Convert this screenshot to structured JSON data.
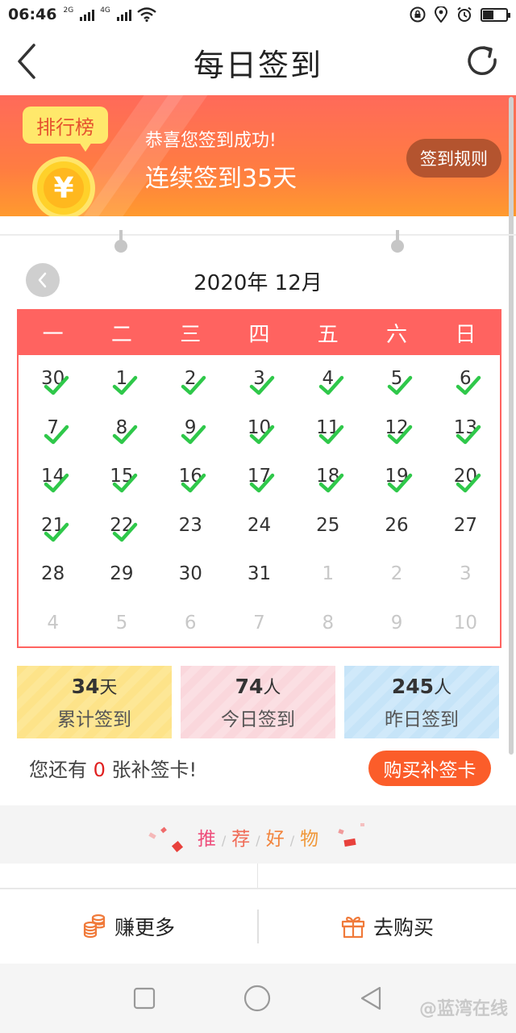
{
  "status_bar": {
    "time": "06:46",
    "net1": "2G",
    "net2": "4G",
    "icons": [
      "signal-icon",
      "signal-icon",
      "wifi-icon",
      "lock-icon",
      "location-icon",
      "alarm-icon",
      "battery-icon"
    ],
    "battery_level": 0.45
  },
  "header": {
    "title": "每日签到",
    "back_icon": "chevron-left-icon",
    "refresh_icon": "refresh-icon"
  },
  "banner": {
    "rank_label": "排行榜",
    "coin_symbol": "¥",
    "success_text": "恭喜您签到成功!",
    "streak_text": "连续签到35天",
    "rules_button": "签到规则"
  },
  "calendar": {
    "month_label": "2020年 12月",
    "weekdays": [
      "一",
      "二",
      "三",
      "四",
      "五",
      "六",
      "日"
    ],
    "days": [
      {
        "label": "30",
        "muted": false,
        "checked": true
      },
      {
        "label": "1",
        "muted": false,
        "checked": true
      },
      {
        "label": "2",
        "muted": false,
        "checked": true
      },
      {
        "label": "3",
        "muted": false,
        "checked": true
      },
      {
        "label": "4",
        "muted": false,
        "checked": true
      },
      {
        "label": "5",
        "muted": false,
        "checked": true
      },
      {
        "label": "6",
        "muted": false,
        "checked": true
      },
      {
        "label": "7",
        "muted": false,
        "checked": true
      },
      {
        "label": "8",
        "muted": false,
        "checked": true
      },
      {
        "label": "9",
        "muted": false,
        "checked": true
      },
      {
        "label": "10",
        "muted": false,
        "checked": true
      },
      {
        "label": "11",
        "muted": false,
        "checked": true
      },
      {
        "label": "12",
        "muted": false,
        "checked": true
      },
      {
        "label": "13",
        "muted": false,
        "checked": true
      },
      {
        "label": "14",
        "muted": false,
        "checked": true
      },
      {
        "label": "15",
        "muted": false,
        "checked": true
      },
      {
        "label": "16",
        "muted": false,
        "checked": true
      },
      {
        "label": "17",
        "muted": false,
        "checked": true
      },
      {
        "label": "18",
        "muted": false,
        "checked": true
      },
      {
        "label": "19",
        "muted": false,
        "checked": true
      },
      {
        "label": "20",
        "muted": false,
        "checked": true
      },
      {
        "label": "21",
        "muted": false,
        "checked": true
      },
      {
        "label": "22",
        "muted": false,
        "checked": true
      },
      {
        "label": "23",
        "muted": false,
        "checked": false
      },
      {
        "label": "24",
        "muted": false,
        "checked": false
      },
      {
        "label": "25",
        "muted": false,
        "checked": false
      },
      {
        "label": "26",
        "muted": false,
        "checked": false
      },
      {
        "label": "27",
        "muted": false,
        "checked": false
      },
      {
        "label": "28",
        "muted": false,
        "checked": false
      },
      {
        "label": "29",
        "muted": false,
        "checked": false
      },
      {
        "label": "30",
        "muted": false,
        "checked": false
      },
      {
        "label": "31",
        "muted": false,
        "checked": false
      },
      {
        "label": "1",
        "muted": true,
        "checked": false
      },
      {
        "label": "2",
        "muted": true,
        "checked": false
      },
      {
        "label": "3",
        "muted": true,
        "checked": false
      },
      {
        "label": "4",
        "muted": true,
        "checked": false
      },
      {
        "label": "5",
        "muted": true,
        "checked": false
      },
      {
        "label": "6",
        "muted": true,
        "checked": false
      },
      {
        "label": "7",
        "muted": true,
        "checked": false
      },
      {
        "label": "8",
        "muted": true,
        "checked": false
      },
      {
        "label": "9",
        "muted": true,
        "checked": false
      },
      {
        "label": "10",
        "muted": true,
        "checked": false
      }
    ]
  },
  "stats": {
    "total": {
      "value": "34",
      "unit": "天",
      "label": "累计签到"
    },
    "today": {
      "value": "74",
      "unit": "人",
      "label": "今日签到"
    },
    "yesterday": {
      "value": "245",
      "unit": "人",
      "label": "昨日签到"
    }
  },
  "makeup": {
    "prefix": "您还有 ",
    "count": "0",
    "suffix": " 张补签卡!",
    "buy_button": "购买补签卡"
  },
  "recommend": {
    "chars": [
      "推",
      "荐",
      "好",
      "物"
    ],
    "separator": "/"
  },
  "bottom_bar": {
    "earn_label": "赚更多",
    "earn_icon": "coins-icon",
    "shop_label": "去购买",
    "shop_icon": "gift-icon"
  },
  "watermark": "@蓝湾在线",
  "colors": {
    "accent": "#ff6360",
    "check": "#2fc84a",
    "banner_start": "#ff6a5a",
    "banner_end": "#ff9a2e",
    "buy_button": "#fb5d2a"
  }
}
